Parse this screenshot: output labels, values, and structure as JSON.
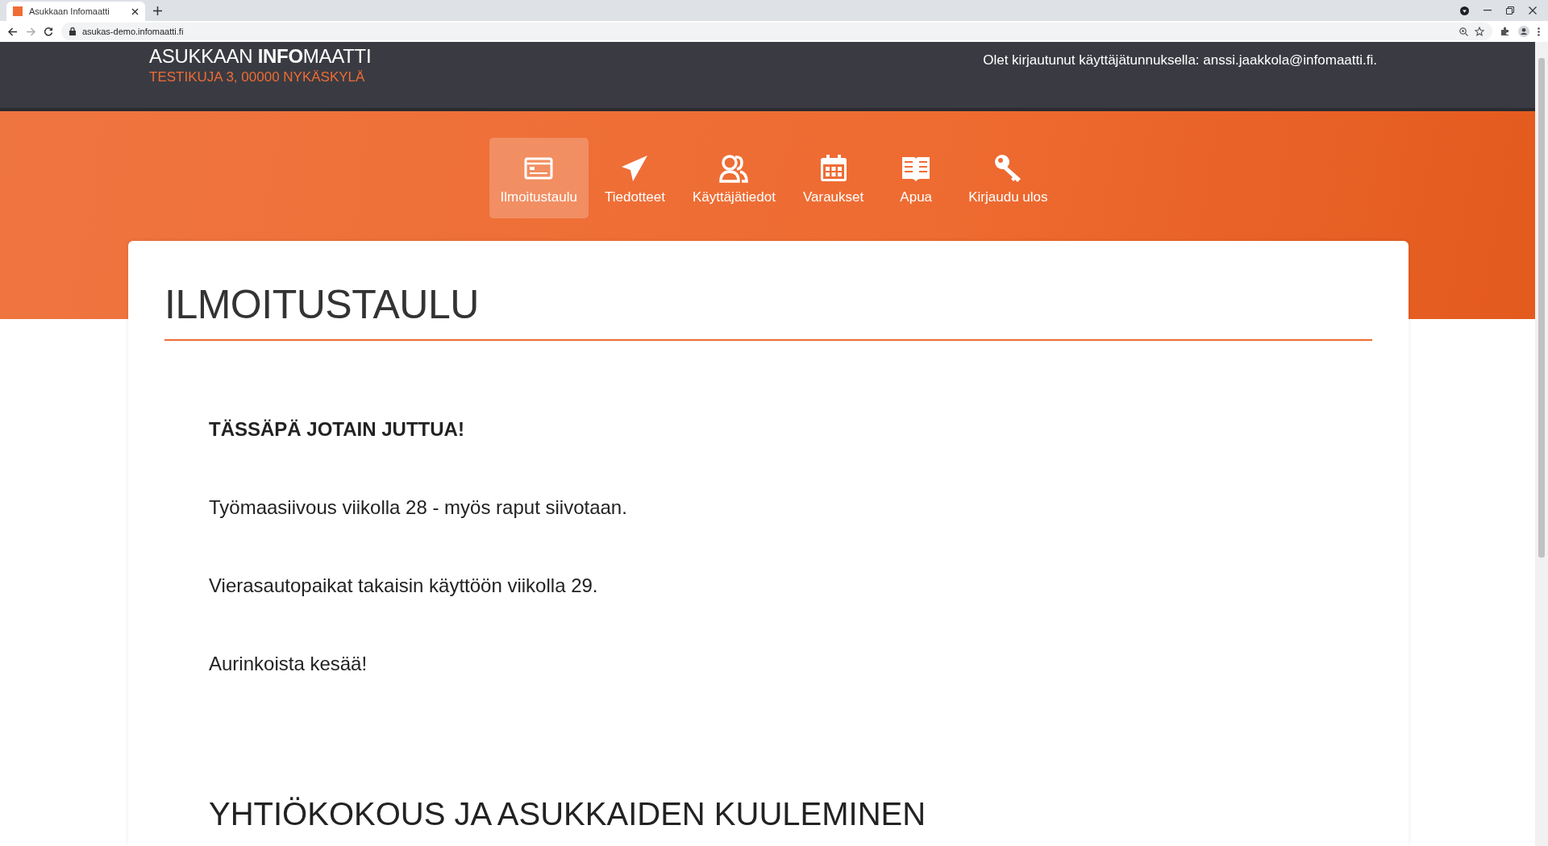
{
  "browser": {
    "tab_title": "Asukkaan Infomaatti",
    "url": "asukas-demo.infomaatti.fi"
  },
  "header": {
    "brand": "ASUKKAAN **INFO**MAATTI",
    "address": "TESTIKUJA 3, 00000 NYKÄSKYLÄ",
    "login_text": "Olet kirjautunut käyttäjätunnuksella: anssi.jaakkola@infomaatti.fi."
  },
  "nav": [
    {
      "label": "Ilmoitustaulu",
      "selected": true
    },
    {
      "label": "Tiedotteet",
      "selected": false
    },
    {
      "label": "Käyttäjätiedot",
      "selected": false
    },
    {
      "label": "Varaukset",
      "selected": false
    },
    {
      "label": "Apua",
      "selected": false
    },
    {
      "label": "Kirjaudu ulos",
      "selected": false
    }
  ],
  "page": {
    "title": "ILMOITUSTAULU",
    "blocks": [
      {
        "kind": "bold",
        "text": "TÄSSÄPÄ JOTAIN JUTTUA!"
      },
      {
        "kind": "paragraph",
        "text": "Työmaasiivous viikolla 28 - myös raput siivotaan."
      },
      {
        "kind": "paragraph",
        "text": "Vierasautopaikat takaisin käyttöön viikolla 29."
      },
      {
        "kind": "paragraph",
        "text": "Aurinkoista kesää!"
      },
      {
        "kind": "heading",
        "text": "YHTIÖKOKOUS JA ASUKKAIDEN KUULEMINEN"
      }
    ]
  }
}
